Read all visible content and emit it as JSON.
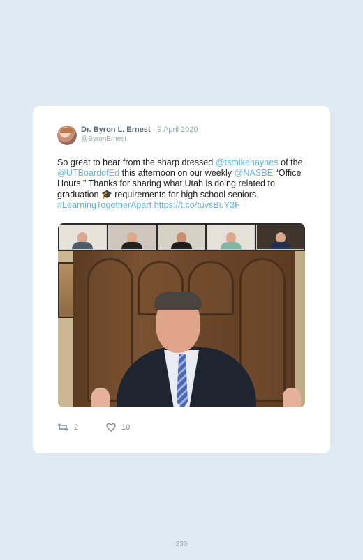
{
  "tweet": {
    "author_name": "Dr. Byron L. Ernest",
    "separator_date": "· 9 April 2020",
    "handle": "@ByronErnest",
    "text": {
      "p1": "So great to hear from the sharp dressed ",
      "mention1": "@tsmikehaynes",
      "p2": " of the ",
      "mention2": "@UTBoardofEd",
      "p3": " this afternoon on our weekly ",
      "mention3": "@NASBE",
      "p4": " “Office Hours.” Thanks for sharing what Utah is doing related to graduation 🎓 requirements for high school seniors. ",
      "hashtag": "#LearningTogetherApart",
      "p5": " ",
      "url": "https://t.co/tuvsBuY3F"
    },
    "retweets": "2",
    "likes": "10"
  },
  "icons": {
    "retweet": "retweet-icon",
    "like": "heart-icon"
  },
  "colors": {
    "link": "#5eb7e0",
    "background": "#dfeaf3",
    "card": "#ffffff"
  },
  "page_number": "239"
}
